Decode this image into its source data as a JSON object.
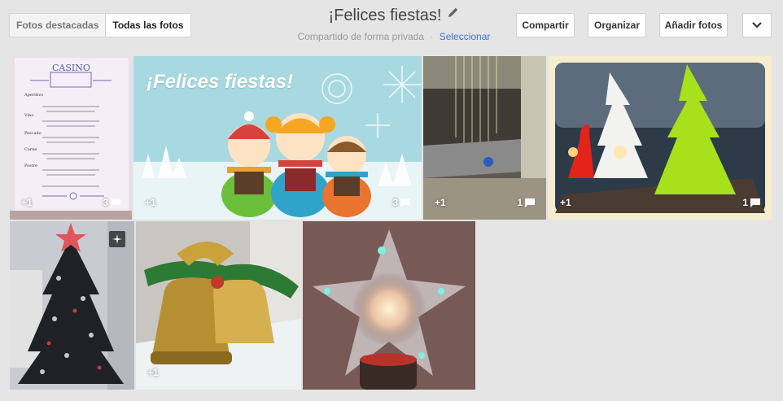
{
  "view_switch": {
    "highlights_label": "Fotos destacadas",
    "all_label": "Todas las fotos"
  },
  "album": {
    "title": "¡Felices fiestas!",
    "sharing_status": "Compartido de forma privada",
    "separator": "·",
    "select_label": "Seleccionar"
  },
  "actions": {
    "share_label": "Compartir",
    "organize_label": "Organizar",
    "add_photos_label": "Añadir fotos"
  },
  "photos": [
    {
      "id": "menu",
      "plus_ones": "+1",
      "comments": "3"
    },
    {
      "id": "greeting-card",
      "plus_ones": "+1",
      "comments": "3",
      "caption": "¡Felices fiestas!"
    },
    {
      "id": "mall-lights",
      "plus_ones": "+1",
      "comments": "1"
    },
    {
      "id": "light-trees",
      "plus_ones": "+1",
      "comments": "1"
    },
    {
      "id": "black-tree",
      "auto_enhanced": true
    },
    {
      "id": "golden-bells",
      "plus_ones": "+1"
    },
    {
      "id": "star-lamp"
    }
  ],
  "menu_card": {
    "logo": "CASINO",
    "lines": [
      "Aperitivo",
      "Vino",
      "Pescado",
      "Carne",
      "Postre"
    ]
  },
  "colors": {
    "background": "#e5e5e5",
    "link": "#3b73d9",
    "button_border": "#d0d0d0"
  },
  "icons": [
    "pencil-icon",
    "chevron-down-icon",
    "comment-icon",
    "auto-enhance-icon"
  ]
}
